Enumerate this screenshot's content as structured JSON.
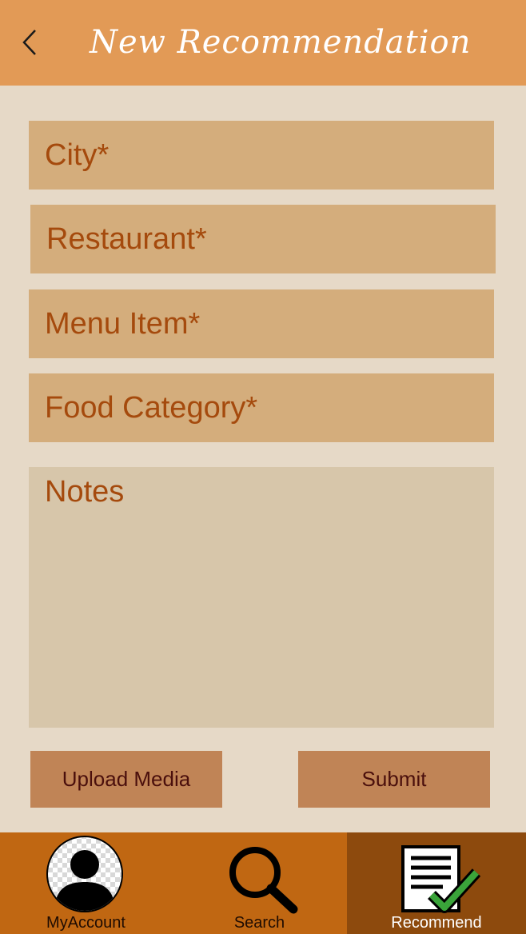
{
  "header": {
    "title": "New Recommendation",
    "back_icon": "chevron-left-icon"
  },
  "form": {
    "city_placeholder": "City*",
    "restaurant_placeholder": "Restaurant*",
    "menu_item_placeholder": "Menu Item*",
    "food_category_placeholder": "Food Category*",
    "notes_placeholder": "Notes"
  },
  "buttons": {
    "upload_label": "Upload Media",
    "submit_label": "Submit"
  },
  "nav": {
    "items": [
      {
        "label": "MyAccount",
        "icon": "user-avatar-icon"
      },
      {
        "label": "Search",
        "icon": "search-icon"
      },
      {
        "label": "Recommend",
        "icon": "checklist-icon",
        "active": true
      }
    ]
  },
  "colors": {
    "header_bg": "#e29a56",
    "page_bg": "#e6d9c7",
    "field_bg": "#d4ad7c",
    "notes_bg": "#d7c6aa",
    "field_text": "#a54a0d",
    "button_bg": "#c08456",
    "button_text": "#4a0f0c",
    "nav_bg": "#c06712",
    "nav_active_bg": "#8d4a0d"
  }
}
